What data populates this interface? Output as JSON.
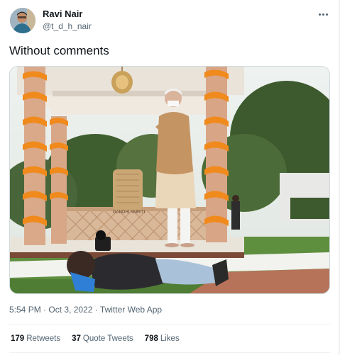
{
  "author": {
    "name": "Ravi Nair",
    "handle": "@t_d_h_nair"
  },
  "tweet": {
    "text": "Without comments"
  },
  "meta": {
    "time": "5:54 PM",
    "sep": "·",
    "date": "Oct 3, 2022",
    "app": "Twitter Web App"
  },
  "stats": {
    "retweets_count": "179",
    "retweets_label": "Retweets",
    "quotes_count": "37",
    "quotes_label": "Quote Tweets",
    "likes_count": "798",
    "likes_label": "Likes"
  },
  "photo": {
    "plaque_text": "GANDHI SMRITI"
  },
  "icons": {
    "more": "more-horizontal-icon"
  }
}
